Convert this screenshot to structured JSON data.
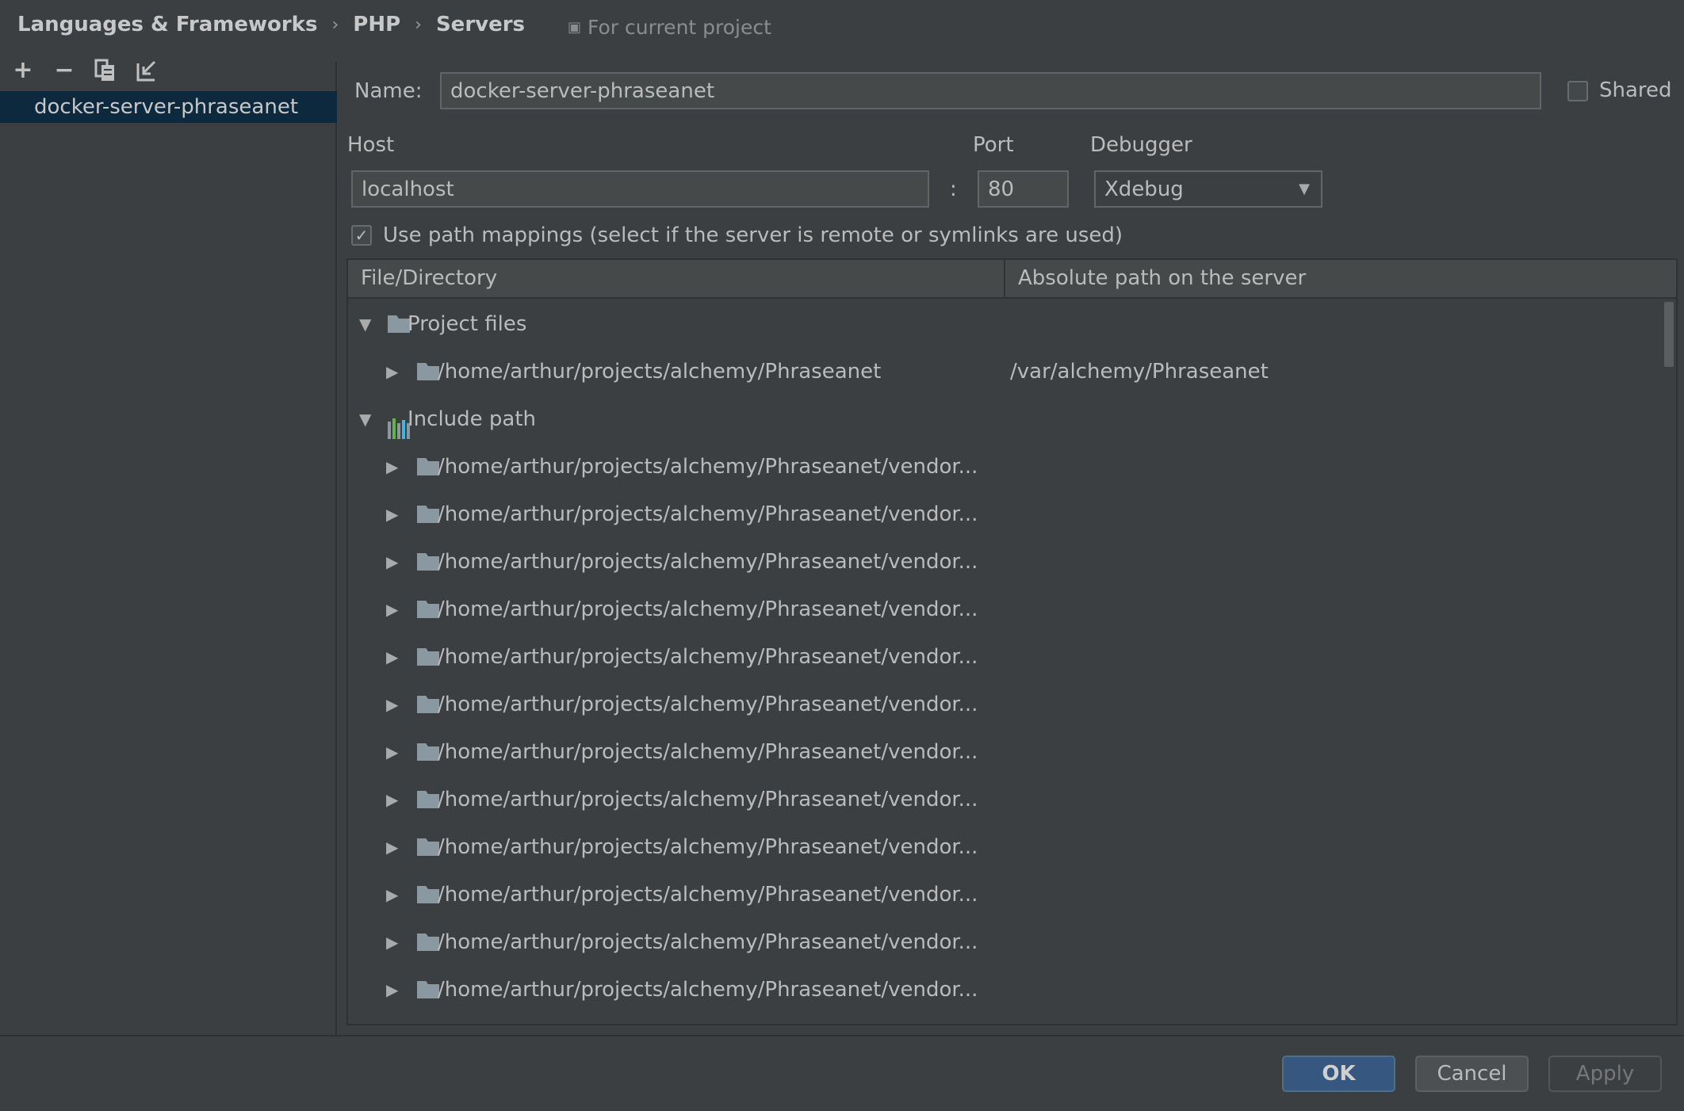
{
  "breadcrumb": {
    "items": [
      "Languages & Frameworks",
      "PHP",
      "Servers"
    ],
    "separator": "›",
    "scope": "For current project"
  },
  "toolbar": {
    "add": "+",
    "remove": "−",
    "copy": "copy-icon",
    "import": "import-icon"
  },
  "sidebar": {
    "items": [
      {
        "label": "docker-server-phraseanet",
        "selected": true
      }
    ]
  },
  "form": {
    "name_label": "Name:",
    "name_value": "docker-server-phraseanet",
    "shared_label": "Shared",
    "shared_checked": false,
    "host_label": "Host",
    "host_value": "localhost",
    "colon": ":",
    "port_label": "Port",
    "port_value": "80",
    "debugger_label": "Debugger",
    "debugger_value": "Xdebug",
    "path_mappings_label": "Use path mappings (select if the server is remote or symlinks are used)",
    "path_mappings_checked": true
  },
  "table": {
    "columns": [
      "File/Directory",
      "Absolute path on the server"
    ],
    "project_files": {
      "label": "Project files",
      "children": [
        {
          "path": "/home/arthur/projects/alchemy/Phraseanet",
          "server": "/var/alchemy/Phraseanet"
        }
      ]
    },
    "include_path": {
      "label": "Include path",
      "children": [
        "/home/arthur/projects/alchemy/Phraseanet/vendor...",
        "/home/arthur/projects/alchemy/Phraseanet/vendor...",
        "/home/arthur/projects/alchemy/Phraseanet/vendor...",
        "/home/arthur/projects/alchemy/Phraseanet/vendor...",
        "/home/arthur/projects/alchemy/Phraseanet/vendor...",
        "/home/arthur/projects/alchemy/Phraseanet/vendor...",
        "/home/arthur/projects/alchemy/Phraseanet/vendor...",
        "/home/arthur/projects/alchemy/Phraseanet/vendor...",
        "/home/arthur/projects/alchemy/Phraseanet/vendor...",
        "/home/arthur/projects/alchemy/Phraseanet/vendor...",
        "/home/arthur/projects/alchemy/Phraseanet/vendor...",
        "/home/arthur/projects/alchemy/Phraseanet/vendor..."
      ]
    }
  },
  "buttons": {
    "ok": "OK",
    "cancel": "Cancel",
    "apply": "Apply"
  },
  "colors": {
    "background": "#3c3f41",
    "selection": "#0d293e",
    "ok_button": "#365880"
  }
}
